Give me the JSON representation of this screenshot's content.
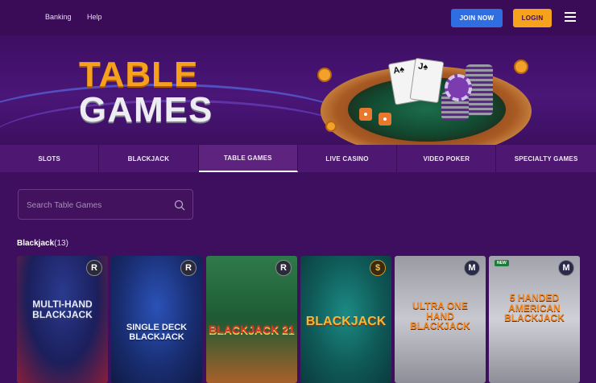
{
  "nav": {
    "links": [
      "Banking",
      "Help"
    ],
    "join_label": "JOIN NOW",
    "login_label": "LOGIN"
  },
  "hero": {
    "line1": "TABLE",
    "line2": "GAMES"
  },
  "tabs": [
    "SLOTS",
    "BLACKJACK",
    "TABLE GAMES",
    "LIVE CASINO",
    "VIDEO POKER",
    "SPECIALTY GAMES"
  ],
  "active_tab": "TABLE GAMES",
  "search": {
    "placeholder": "Search Table Games",
    "value": ""
  },
  "section": {
    "title": "Blackjack",
    "count": "(13)"
  },
  "games": [
    {
      "title": "MULTI-HAND BLACKJACK",
      "provider_icon": "R",
      "badge": ""
    },
    {
      "title": "SINGLE DECK BLACKJACK",
      "provider_icon": "R",
      "badge": ""
    },
    {
      "title": "BLACKJACK 21",
      "provider_icon": "R",
      "badge": ""
    },
    {
      "title": "BLACKJACK",
      "provider_icon": "$",
      "badge": ""
    },
    {
      "title": "ULTRA ONE HAND BLACKJACK",
      "provider_icon": "M",
      "badge": ""
    },
    {
      "title": "5 HANDED AMERICAN BLACKJACK",
      "provider_icon": "M",
      "badge": "NEW"
    }
  ],
  "colors": {
    "background": "#3e0f5e",
    "join_button": "#2f6ee0",
    "login_button": "#f7a21c",
    "hero_orange": "#f6a11e"
  }
}
